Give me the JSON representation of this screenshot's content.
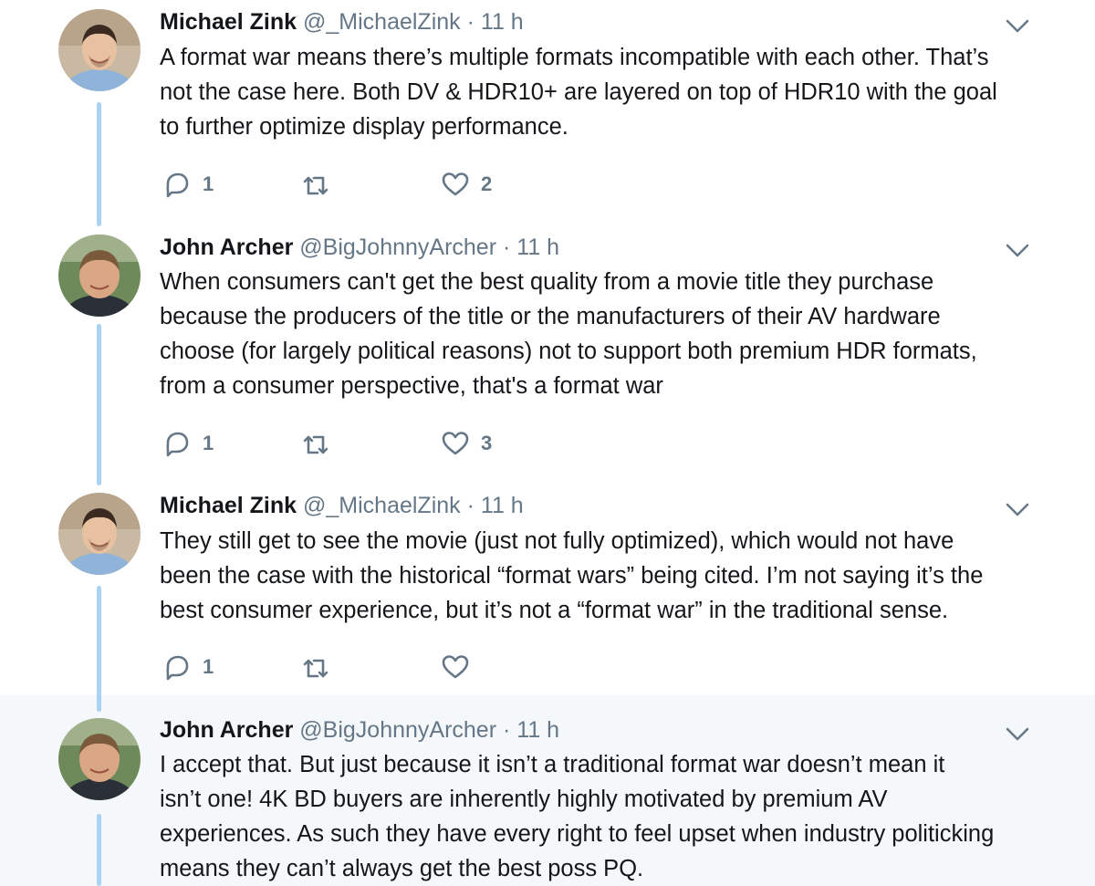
{
  "colors": {
    "thread_line": "#a9d2f3",
    "secondary_text": "#657786",
    "primary_text": "#14171a",
    "highlight_bg": "#f5f8fa"
  },
  "tweets": [
    {
      "name": "Michael Zink",
      "handle": "@_MichaelZink",
      "separator": "·",
      "time": "11 h",
      "avatar_icon": "avatar-michael-zink",
      "lines": [
        "A format war means there’s multiple formats incompatible with each other. That’s",
        "not the case here. Both DV & HDR10+ are layered on top of HDR10 with the goal",
        "to further optimize display performance."
      ],
      "replies": "1",
      "retweets": "",
      "likes": "2"
    },
    {
      "name": "John Archer",
      "handle": "@BigJohnnyArcher",
      "separator": "·",
      "time": "11 h",
      "avatar_icon": "avatar-john-archer",
      "lines": [
        "When consumers can't get the best quality from a movie title they purchase",
        "because the producers of the title or the manufacturers of their AV hardware",
        "choose (for largely political reasons) not to support both premium HDR formats,",
        "from a consumer perspective, that's a format war"
      ],
      "replies": "1",
      "retweets": "",
      "likes": "3"
    },
    {
      "name": "Michael Zink",
      "handle": "@_MichaelZink",
      "separator": "·",
      "time": "11 h",
      "avatar_icon": "avatar-michael-zink",
      "lines": [
        "They still get to see the movie (just not fully optimized), which would not have",
        "been the case with the historical “format wars” being cited. I’m not saying it’s the",
        "best consumer experience, but it’s not a “format war” in the traditional sense."
      ],
      "replies": "1",
      "retweets": "",
      "likes": ""
    },
    {
      "name": "John Archer",
      "handle": "@BigJohnnyArcher",
      "separator": "·",
      "time": "11 h",
      "avatar_icon": "avatar-john-archer",
      "lines": [
        "I accept that. But just because it isn’t a traditional format war doesn’t mean it",
        "isn’t one! 4K BD buyers are inherently highly motivated by premium AV",
        "experiences. As such they have every right to feel upset when industry politicking",
        "means they can’t always get the best poss PQ."
      ]
    }
  ]
}
